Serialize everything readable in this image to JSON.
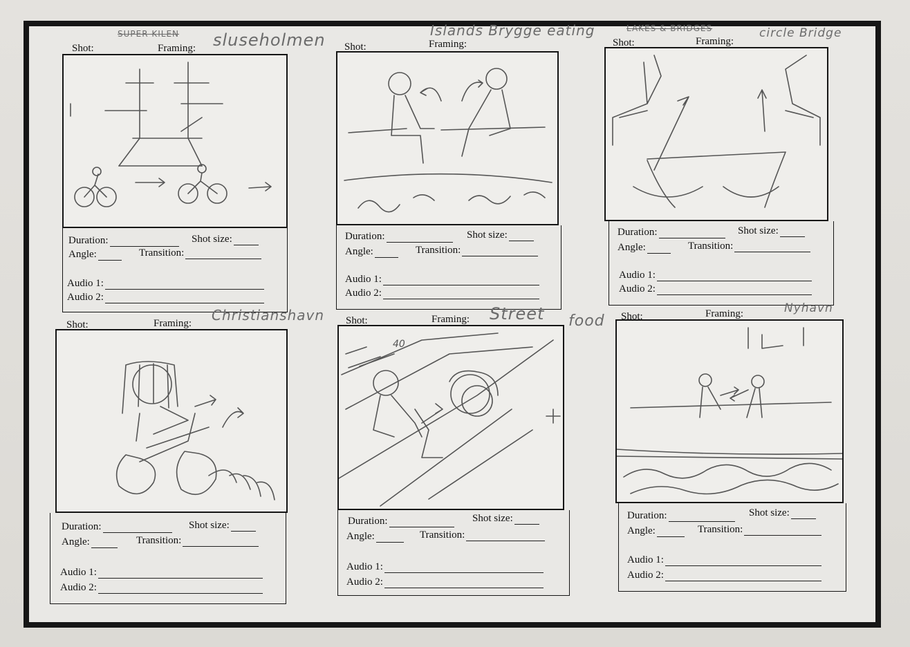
{
  "labels": {
    "shot": "Shot:",
    "framing": "Framing:",
    "duration": "Duration:",
    "shot_size": "Shot size:",
    "angle": "Angle:",
    "transition": "Transition:",
    "audio1": "Audio 1:",
    "audio2": "Audio 2:"
  },
  "panels": [
    {
      "strike": "Super Kilen",
      "location": "sluseholmen",
      "extra": ""
    },
    {
      "strike": "",
      "location": "Islands Brygge eating",
      "extra": ""
    },
    {
      "strike": "Lakes & Bridges",
      "location": "circle Bridge",
      "extra": ""
    },
    {
      "strike": "",
      "location": "Christianshavn",
      "extra": ""
    },
    {
      "strike": "",
      "location": "Street",
      "extra": "food"
    },
    {
      "strike": "",
      "location": "Nyhavn",
      "extra": ""
    }
  ],
  "sketch_text": {
    "sign_40": "40"
  }
}
